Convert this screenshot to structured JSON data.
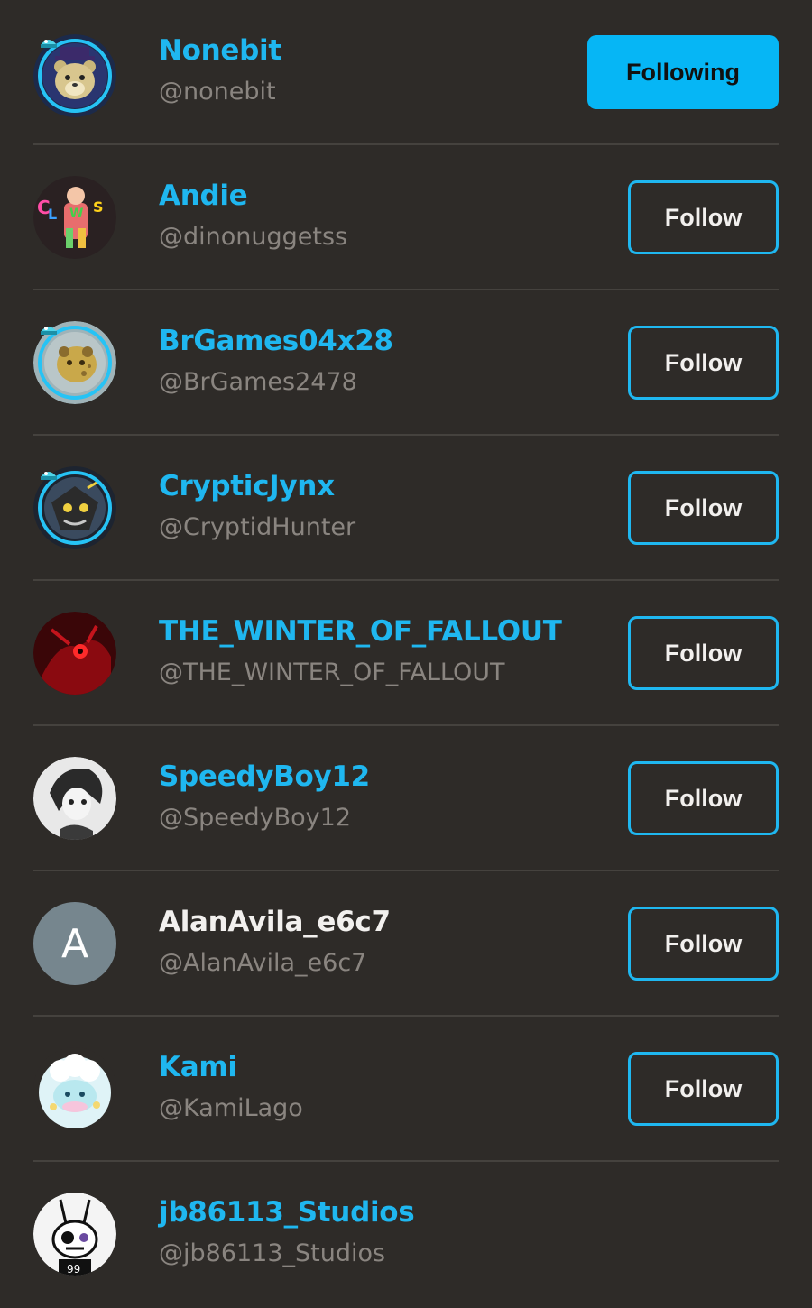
{
  "colors": {
    "background": "#2e2b28",
    "accent": "#1fb7f0",
    "divider": "#45423e",
    "handle": "#8a8580"
  },
  "users": [
    {
      "name": "Nonebit",
      "handle": "@nonebit",
      "button": "Following",
      "avatar": "teddy-bear-icon"
    },
    {
      "name": "Andie",
      "handle": "@dinonuggetss",
      "button": "Follow",
      "avatar": "clown-art-avatar"
    },
    {
      "name": "BrGames04x28",
      "handle": "@BrGames2478",
      "button": "Follow",
      "avatar": "cheese-bear-avatar"
    },
    {
      "name": "CrypticJynx",
      "handle": "@CryptidHunter",
      "button": "Follow",
      "avatar": "character-art-avatar"
    },
    {
      "name": "THE_WINTER_OF_FALLOUT",
      "handle": "@THE_WINTER_OF_FALLOUT",
      "button": "Follow",
      "avatar": "red-creature-avatar"
    },
    {
      "name": "SpeedyBoy12",
      "handle": "@SpeedyBoy12",
      "button": "Follow",
      "avatar": "sketch-character-avatar"
    },
    {
      "name": "AlanAvila_e6c7",
      "handle": "@AlanAvila_e6c7",
      "button": "Follow",
      "avatar": "letter-avatar",
      "avatar_letter": "A"
    },
    {
      "name": "Kami",
      "handle": "@KamiLago",
      "button": "Follow",
      "avatar": "cloud-creature-avatar"
    },
    {
      "name": "jb86113_Studios",
      "handle": "@jb86113_Studios",
      "button": "",
      "avatar": "bunny-sketch-avatar",
      "avatar_text": "99"
    }
  ]
}
